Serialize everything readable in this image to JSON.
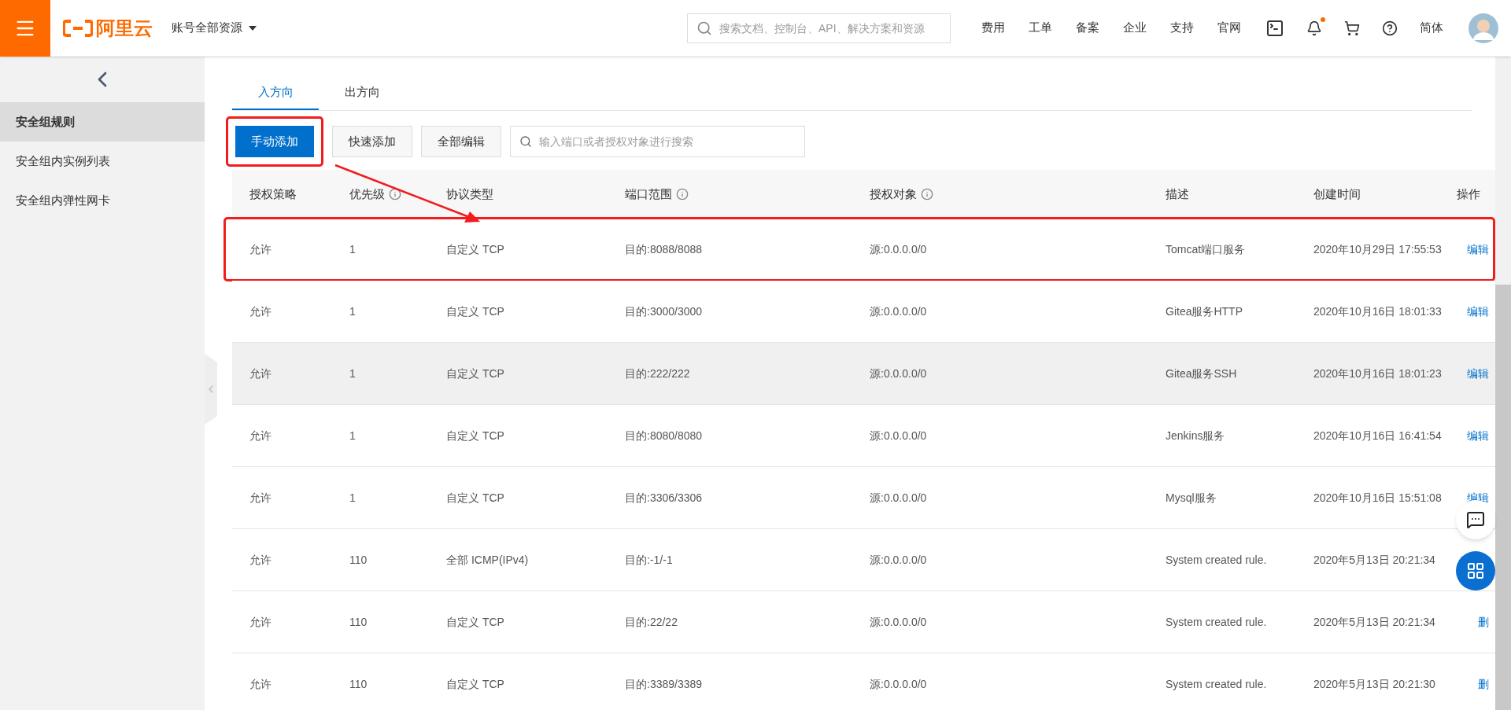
{
  "topbar": {
    "logo": "阿里云",
    "account": "账号全部资源",
    "search": {
      "placeholder": "搜索文档、控制台、API、解决方案和资源"
    },
    "links": [
      "费用",
      "工单",
      "备案",
      "企业",
      "支持",
      "官网"
    ],
    "notification_dot": true,
    "language": "简体"
  },
  "sidebar": {
    "items": [
      {
        "label": "安全组规则",
        "selected": true
      },
      {
        "label": "安全组内实例列表",
        "selected": false
      },
      {
        "label": "安全组内弹性网卡",
        "selected": false
      }
    ]
  },
  "tabs": [
    {
      "label": "入方向",
      "selected": true
    },
    {
      "label": "出方向",
      "selected": false
    }
  ],
  "toolbar": {
    "buttons": [
      {
        "label": "手动添加",
        "kind": "primary",
        "annotated": true
      },
      {
        "label": "快速添加",
        "kind": "default",
        "annotated": false
      },
      {
        "label": "全部编辑",
        "kind": "default",
        "annotated": false
      }
    ],
    "search": {
      "placeholder": "输入端口或者授权对象进行搜索"
    }
  },
  "table": {
    "columns": [
      {
        "label": "授权策略",
        "info": false
      },
      {
        "label": "优先级",
        "info": true
      },
      {
        "label": "协议类型",
        "info": false
      },
      {
        "label": "端口范围",
        "info": true
      },
      {
        "label": "授权对象",
        "info": true
      },
      {
        "label": "描述",
        "info": false
      },
      {
        "label": "创建时间",
        "info": false
      },
      {
        "label": "操作",
        "info": false
      }
    ],
    "rows": [
      {
        "cells": [
          "允许",
          "1",
          "自定义 TCP",
          "目的:8088/8088",
          "源:0.0.0.0/0",
          "Tomcat端口服务",
          "2020年10月29日 17:55:53"
        ],
        "actions": [
          "编辑"
        ],
        "highlighted": false,
        "annotated": true
      },
      {
        "cells": [
          "允许",
          "1",
          "自定义 TCP",
          "目的:3000/3000",
          "源:0.0.0.0/0",
          "Gitea服务HTTP",
          "2020年10月16日 18:01:33"
        ],
        "actions": [
          "编辑"
        ],
        "highlighted": false,
        "annotated": false
      },
      {
        "cells": [
          "允许",
          "1",
          "自定义 TCP",
          "目的:222/222",
          "源:0.0.0.0/0",
          "Gitea服务SSH",
          "2020年10月16日 18:01:23"
        ],
        "actions": [
          "编辑"
        ],
        "highlighted": true,
        "annotated": false
      },
      {
        "cells": [
          "允许",
          "1",
          "自定义 TCP",
          "目的:8080/8080",
          "源:0.0.0.0/0",
          "Jenkins服务",
          "2020年10月16日 16:41:54"
        ],
        "actions": [
          "编辑"
        ],
        "highlighted": false,
        "annotated": false
      },
      {
        "cells": [
          "允许",
          "1",
          "自定义 TCP",
          "目的:3306/3306",
          "源:0.0.0.0/0",
          "Mysql服务",
          "2020年10月16日 15:51:08"
        ],
        "actions": [
          "编辑"
        ],
        "highlighted": false,
        "annotated": false
      },
      {
        "cells": [
          "允许",
          "110",
          "全部 ICMP(IPv4)",
          "目的:-1/-1",
          "源:0.0.0.0/0",
          "System created rule.",
          "2020年5月13日 20:21:34"
        ],
        "actions": [],
        "highlighted": false,
        "annotated": false
      },
      {
        "cells": [
          "允许",
          "110",
          "自定义 TCP",
          "目的:22/22",
          "源:0.0.0.0/0",
          "System created rule.",
          "2020年5月13日 20:21:34"
        ],
        "actions": [
          "删"
        ],
        "highlighted": false,
        "annotated": false
      },
      {
        "cells": [
          "允许",
          "110",
          "自定义 TCP",
          "目的:3389/3389",
          "源:0.0.0.0/0",
          "System created rule.",
          "2020年5月13日 20:21:30"
        ],
        "actions": [
          "删"
        ],
        "highlighted": false,
        "annotated": false
      }
    ]
  }
}
